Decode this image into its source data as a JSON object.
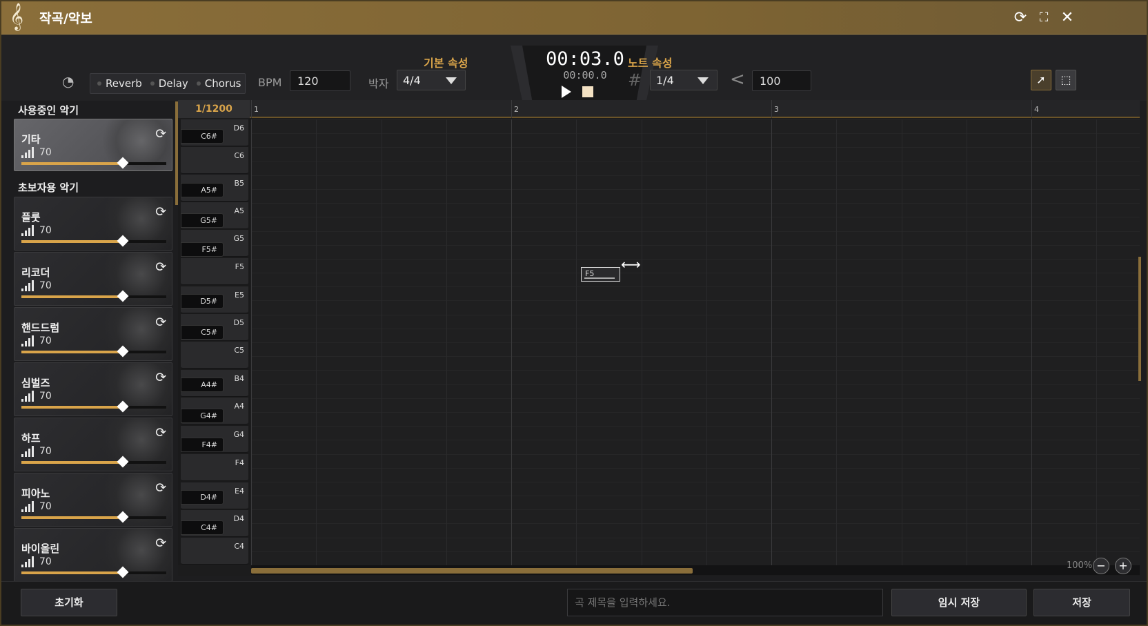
{
  "window": {
    "title": "작곡/악보",
    "icon": "treble-clef-icon"
  },
  "effects": [
    "Reverb",
    "Delay",
    "Chorus"
  ],
  "tempo": {
    "label": "BPM",
    "value": "120"
  },
  "meter": {
    "label": "박자",
    "value": "4/4"
  },
  "basic_props_label": "기본 속성",
  "note_props_label": "노트 속성",
  "time": {
    "current": "00:03.0",
    "sub": "00:00.0"
  },
  "note_length": "1/4",
  "velocity": "100",
  "sidebar": {
    "in_use_title": "사용중인 악기",
    "beginner_title": "초보자용 악기",
    "active": {
      "name": "기타",
      "volume": "70",
      "level": 0.7
    },
    "instruments": [
      {
        "name": "플룻",
        "volume": "70",
        "level": 0.7
      },
      {
        "name": "리코더",
        "volume": "70",
        "level": 0.7
      },
      {
        "name": "핸드드럼",
        "volume": "70",
        "level": 0.7
      },
      {
        "name": "심벌즈",
        "volume": "70",
        "level": 0.7
      },
      {
        "name": "하프",
        "volume": "70",
        "level": 0.7
      },
      {
        "name": "피아노",
        "volume": "70",
        "level": 0.7
      },
      {
        "name": "바이올린",
        "volume": "70",
        "level": 0.7
      }
    ]
  },
  "ruler": {
    "resolution": "1/1200",
    "bars": [
      "1",
      "2",
      "3",
      "4"
    ]
  },
  "keys": {
    "white": [
      "D6",
      "C6",
      "B5",
      "A5",
      "G5",
      "F5",
      "E5",
      "D5",
      "C5",
      "B4",
      "A4",
      "G4",
      "F4",
      "E4",
      "D4",
      "C4"
    ],
    "black": [
      "C6#",
      "A5#",
      "G5#",
      "F5#",
      "D5#",
      "C5#",
      "A4#",
      "G4#",
      "F4#",
      "D4#",
      "C4#"
    ]
  },
  "note": {
    "label": "F5"
  },
  "zoom": "100%",
  "footer": {
    "reset": "초기화",
    "title_placeholder": "곡 제목을 입력하세요.",
    "temp_save": "임시 저장",
    "save": "저장"
  },
  "colors": {
    "accent": "#d9a44a",
    "titlebar": "#8a6e3a"
  }
}
